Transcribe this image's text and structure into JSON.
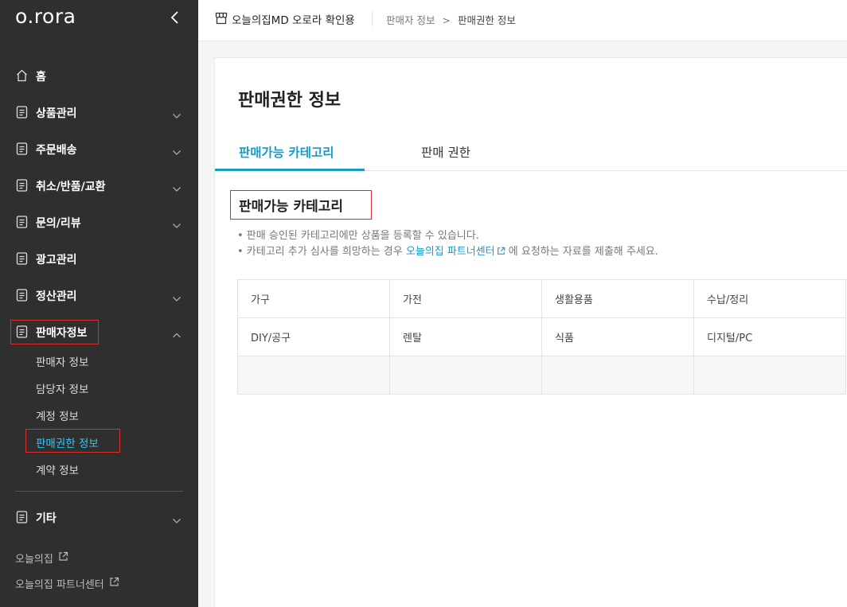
{
  "sidebar": {
    "logo": "o.rora",
    "nav": [
      {
        "label": "홈",
        "icon": "home-icon"
      },
      {
        "label": "상품관리",
        "icon": "document-icon"
      },
      {
        "label": "주문배송",
        "icon": "document-icon"
      },
      {
        "label": "취소/반품/교환",
        "icon": "document-icon"
      },
      {
        "label": "문의/리뷰",
        "icon": "document-icon"
      },
      {
        "label": "광고관리",
        "icon": "document-icon"
      },
      {
        "label": "정산관리",
        "icon": "document-icon"
      },
      {
        "label": "판매자정보",
        "icon": "document-icon"
      },
      {
        "label": "기타",
        "icon": "document-icon"
      }
    ],
    "sub_items": [
      {
        "label": "판매자 정보"
      },
      {
        "label": "담당자 정보"
      },
      {
        "label": "계정 정보"
      },
      {
        "label": "판매권한 정보"
      },
      {
        "label": "계약 정보"
      }
    ],
    "external_links": [
      {
        "label": "오늘의집"
      },
      {
        "label": "오늘의집 파트너센터"
      }
    ]
  },
  "header": {
    "store_name": "오늘의집MD 오로라 확인용",
    "breadcrumb": {
      "parent": "판매자 정보",
      "separator": ">",
      "current": "판매권한 정보"
    }
  },
  "main": {
    "title": "판매권한 정보",
    "tabs": [
      {
        "label": "판매가능 카테고리"
      },
      {
        "label": "판매 권한"
      }
    ],
    "section_title": "판매가능 카테고리",
    "notes": [
      {
        "text": "• 판매 승인된 카테고리에만 상품을 등록할 수 있습니다."
      },
      {
        "prefix": "• 카테고리 추가 심사를 희망하는 경우 ",
        "link": "오늘의집 파트너센터",
        "suffix": " 에 요청하는 자료를 제출해 주세요."
      }
    ],
    "categories": [
      [
        "가구",
        "가전",
        "생활용품",
        "수납/정리"
      ],
      [
        "DIY/공구",
        "렌탈",
        "식품",
        "디지털/PC"
      ],
      [
        "",
        "",
        "",
        ""
      ]
    ]
  },
  "colors": {
    "sidebar_bg": "#2f2f2f",
    "accent": "#1b9bc3",
    "active_sub": "#35c5f0",
    "highlight_box": "#d9302c"
  }
}
